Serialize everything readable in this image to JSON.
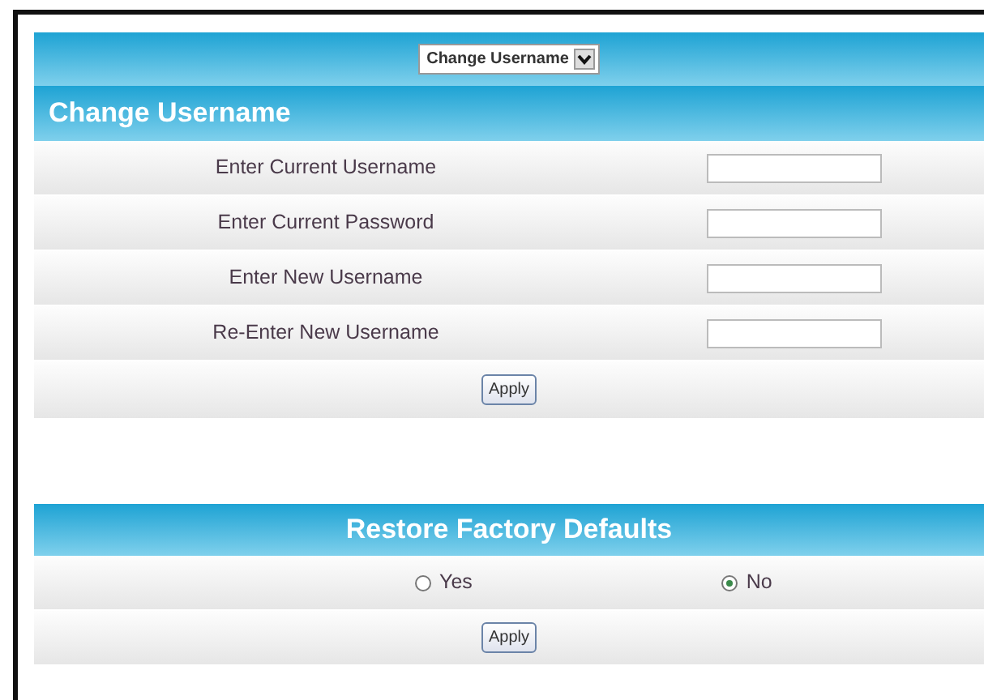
{
  "page_select": {
    "value": "Change Username"
  },
  "change_username": {
    "title": "Change Username",
    "fields": [
      {
        "label": "Enter Current Username"
      },
      {
        "label": "Enter Current Password"
      },
      {
        "label": "Enter New Username"
      },
      {
        "label": "Re-Enter New Username"
      }
    ],
    "button": "Apply"
  },
  "restore_defaults": {
    "title": "Restore Factory Defaults",
    "options": [
      {
        "label": "Yes",
        "selected": false
      },
      {
        "label": "No",
        "selected": true
      }
    ],
    "button": "Apply"
  }
}
